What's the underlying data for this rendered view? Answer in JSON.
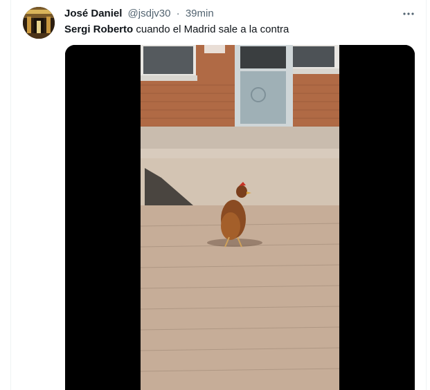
{
  "tweet": {
    "author_name": "José Daniel",
    "author_handle": "@jsdjv30",
    "separator": "·",
    "time": "39min",
    "text_highlight": "Sergi Roberto",
    "text_rest": " cuando el Madrid sale a la contra",
    "more_icon": "more-horizontal-icon",
    "avatar_icon": "avatar-image",
    "media_icon": "video-still"
  }
}
